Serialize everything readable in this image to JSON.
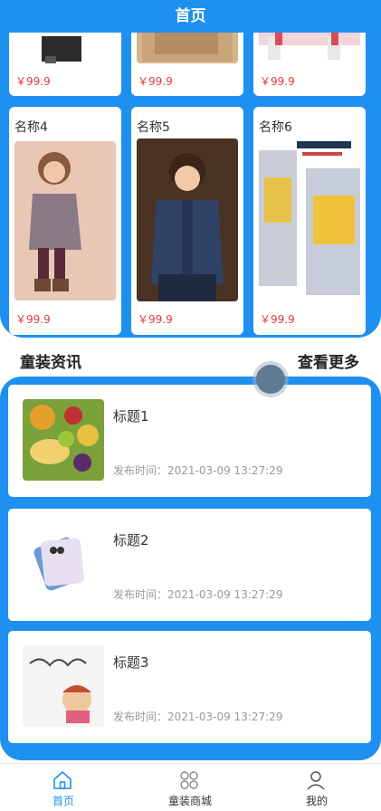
{
  "header": {
    "title": "首页"
  },
  "products": [
    {
      "name": "",
      "price": "￥99.9"
    },
    {
      "name": "",
      "price": "￥99.9"
    },
    {
      "name": "",
      "price": "￥99.9"
    },
    {
      "name": "名称4",
      "price": "￥99.9"
    },
    {
      "name": "名称5",
      "price": "￥99.9"
    },
    {
      "name": "名称6",
      "price": "￥99.9"
    }
  ],
  "section": {
    "title": "童装资讯",
    "more": "查看更多"
  },
  "news": [
    {
      "title": "标题1",
      "date": "发布时间：2021-03-09 13:27:29"
    },
    {
      "title": "标题2",
      "date": "发布时间：2021-03-09 13:27:29"
    },
    {
      "title": "标题3",
      "date": "发布时间：2021-03-09 13:27:29"
    }
  ],
  "tabbar": {
    "items": [
      {
        "label": "首页",
        "icon": "home-icon",
        "active": true
      },
      {
        "label": "童装商城",
        "icon": "grid-icon",
        "active": false
      },
      {
        "label": "我的",
        "icon": "user-icon",
        "active": false
      }
    ],
    "active_color": "#1e90f0"
  },
  "colors": {
    "primary": "#1e90f0",
    "price": "#e03a3a"
  }
}
